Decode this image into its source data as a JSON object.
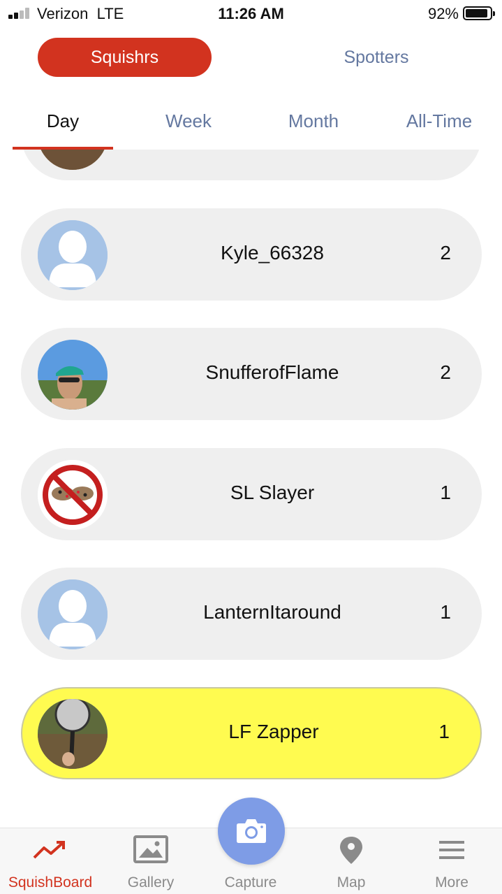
{
  "status_bar": {
    "carrier": "Verizon",
    "network": "LTE",
    "time": "11:26 AM",
    "battery": "92%"
  },
  "header": {
    "segments": [
      {
        "label": "Squishrs",
        "active": true
      },
      {
        "label": "Spotters",
        "active": false
      }
    ]
  },
  "period_tabs": [
    {
      "label": "Day",
      "active": true
    },
    {
      "label": "Week",
      "active": false
    },
    {
      "label": "Month",
      "active": false
    },
    {
      "label": "All-Time",
      "active": false
    }
  ],
  "leaderboard": [
    {
      "name": "Kyle_66328",
      "count": "2",
      "avatar": "default-user-avatar"
    },
    {
      "name": "SnufferofFlame",
      "count": "2",
      "avatar": "photo-avatar-person-cap"
    },
    {
      "name": "SL Slayer",
      "count": "1",
      "avatar": "no-lanternfly-sign"
    },
    {
      "name": "LanternItaround",
      "count": "1",
      "avatar": "default-user-avatar"
    },
    {
      "name": "LF Zapper",
      "count": "1",
      "avatar": "photo-avatar-fly-swatter",
      "highlighted": true
    }
  ],
  "bottom_nav": {
    "items": [
      {
        "label": "SquishBoard",
        "icon": "trending-up-icon",
        "active": true
      },
      {
        "label": "Gallery",
        "icon": "image-icon",
        "active": false
      },
      {
        "label": "Capture",
        "icon": "camera-icon",
        "active": false
      },
      {
        "label": "Map",
        "icon": "map-pin-icon",
        "active": false
      },
      {
        "label": "More",
        "icon": "menu-icon",
        "active": false
      }
    ]
  },
  "colors": {
    "accent_red": "#d2331f",
    "tab_inactive": "#6478a0",
    "row_bg": "#efefef",
    "highlight_row": "#fffb50",
    "capture_button": "#7e9ce6"
  }
}
